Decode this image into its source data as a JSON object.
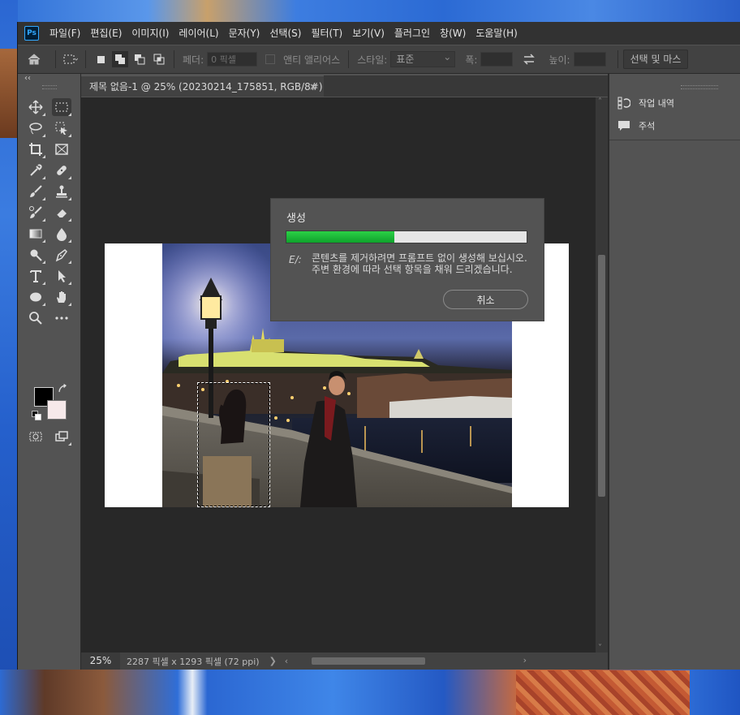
{
  "menubar": {
    "logo": "Ps",
    "items": [
      "파일(F)",
      "편집(E)",
      "이미지(I)",
      "레이어(L)",
      "문자(Y)",
      "선택(S)",
      "필터(T)",
      "보기(V)",
      "플러그인",
      "창(W)",
      "도움말(H)"
    ]
  },
  "options": {
    "feather_label": "페더:",
    "feather_value": "0 픽셀",
    "antialias_label": "앤티 앨리어스",
    "style_label": "스타일:",
    "style_value": "표준",
    "width_label": "폭:",
    "height_label": "높이:",
    "select_mask_label": "선택 및 마스"
  },
  "document": {
    "tab_title": "제목 없음-1 @ 25% (20230214_175851, RGB/8#) *",
    "close_glyph": "×"
  },
  "dialog": {
    "title": "생성",
    "progress_percent": 45,
    "tip_icon": "E/:",
    "tip_text": "콘텐츠를 제거하려면 프롬프트 없이 생성해 보십시오. 주변 환경에 따라 선택 항목을 채워 드리겠습니다.",
    "cancel_label": "취소"
  },
  "status": {
    "zoom": "25%",
    "doc_info": "2287 픽셀 x 1293 픽셀 (72 ppi)",
    "more_arrow": "❯",
    "scroll_left": "‹",
    "scroll_right": "›"
  },
  "toolbar": {
    "collapse": "‹‹"
  },
  "right_panel": {
    "items": [
      {
        "icon": "history-icon",
        "label": "작업 내역"
      },
      {
        "icon": "comment-icon",
        "label": "주석"
      }
    ]
  },
  "colors": {
    "foreground": "#000000",
    "background": "#f6e9ea",
    "progress": "#1fb83a"
  }
}
